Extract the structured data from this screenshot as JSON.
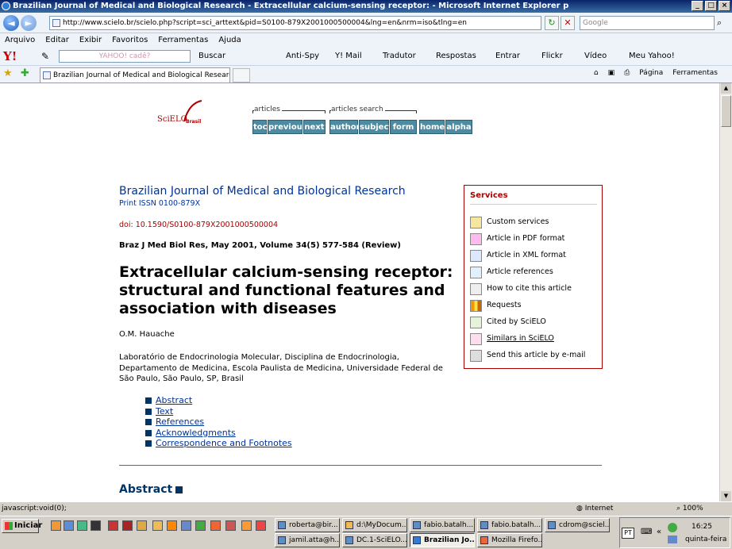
{
  "window": {
    "title": "Brazilian Journal of Medical and Biological Research - Extracellular calcium-sensing receptor:  - Microsoft Internet Explorer p",
    "btn_min": "_",
    "btn_max": "□",
    "btn_close": "×"
  },
  "address": {
    "back": "◄",
    "fwd": "►",
    "url": "http://www.scielo.br/scielo.php?script=sci_arttext&pid=S0100-879X2001000500004&lng=en&nrm=iso&tlng=en",
    "refresh": "↻",
    "stop": "✕",
    "search_placeholder": "Google"
  },
  "menu": [
    "Arquivo",
    "Editar",
    "Exibir",
    "Favoritos",
    "Ferramentas",
    "Ajuda"
  ],
  "yahoo_toolbar": {
    "logo": "Y!",
    "search_placeholder": "YAHOO! cadê?",
    "buscar": "Buscar",
    "items": [
      "Anti-Spy",
      "Y! Mail",
      "Tradutor",
      "Respostas",
      "Entrar",
      "Flickr",
      "Vídeo",
      "Meu Yahoo!"
    ]
  },
  "tab": {
    "title": "Brazilian Journal of Medical and Biological Research - E..."
  },
  "command_bar": {
    "pagina": "Página",
    "ferramentas": "Ferramentas"
  },
  "page": {
    "logo": {
      "text": "SciELO",
      "sub": "Brasil"
    },
    "nav_articles_label": "articles",
    "nav_search_label": "articles search",
    "buttons": {
      "toc": "toc",
      "previous": "previous",
      "next": "next",
      "author": "author",
      "subject": "subject",
      "form": "form",
      "home": "home",
      "alpha": "alpha"
    },
    "journal": "Brazilian Journal of Medical and Biological Research",
    "issn": "Print ISSN 0100-879X",
    "doi": "doi: 10.1590/S0100-879X2001000500004",
    "citation": "Braz J Med Biol Res, May 2001, Volume 34(5) 577-584 (Review)",
    "title": "Extracellular calcium-sensing receptor: structural and functional features and association with diseases",
    "author": "O.M. Hauache",
    "affiliation": "Laboratório de Endocrinologia Molecular, Disciplina de Endocrinologia, Departamento de Medicina, Escola Paulista de Medicina, Universidade Federal de São Paulo, São Paulo, SP, Brasil",
    "toc_links": [
      "Abstract",
      "Text",
      "References",
      "Acknowledgments",
      "Correspondence and Footnotes"
    ],
    "abstract_heading": "Abstract"
  },
  "services": {
    "heading": "Services",
    "items": [
      "Custom services",
      "Article in PDF format",
      "Article in XML format",
      "Article references",
      "How to cite this article",
      "Requests",
      "Cited by SciELO",
      "Similars in SciELO",
      "Send this article by e-mail"
    ]
  },
  "status": {
    "text": "javascript:void(0);",
    "zone": "Internet",
    "zoom": "100%"
  },
  "taskbar": {
    "start": "Iniciar",
    "row1": [
      "roberta@bir...",
      "d:\\MyDocum...",
      "fabio.batalh...",
      "fabio.batalh...",
      "cdrom@sciel..."
    ],
    "row2": [
      "jamil.atta@h...",
      "DC.1-SciELO...",
      "Brazilian Jo...",
      "Mozilla Firefo..."
    ],
    "lang": "PT",
    "time": "16:25",
    "day": "quinta-feira"
  }
}
